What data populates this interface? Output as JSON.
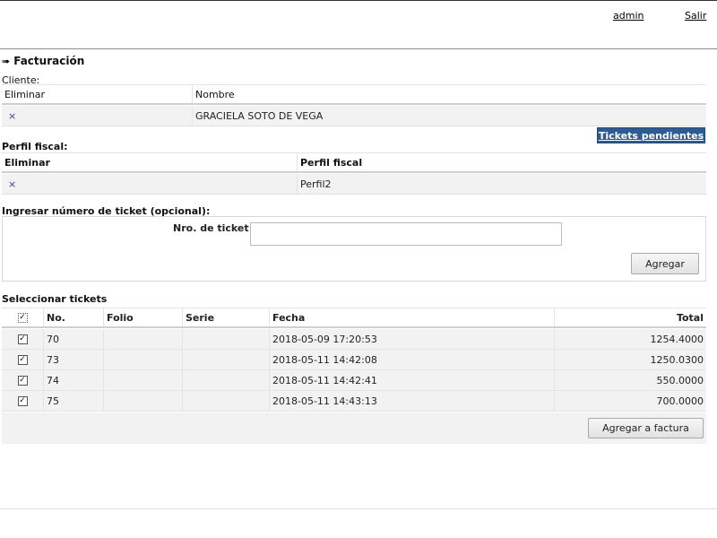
{
  "header": {
    "user_link": "admin",
    "logout_link": "Salir"
  },
  "section": {
    "title": "Facturación",
    "arrow": "➠"
  },
  "cliente": {
    "label": "Cliente:",
    "columns": [
      "Eliminar",
      "Nombre"
    ],
    "rows": [
      {
        "remove": "×",
        "nombre": "GRACIELA SOTO DE VEGA"
      }
    ]
  },
  "pendientes_button": "Tickets pendientes",
  "perfil": {
    "label": "Perfil fiscal:",
    "columns": [
      "Eliminar",
      "Perfil fiscal"
    ],
    "rows": [
      {
        "remove": "×",
        "perfil": "Perfil2"
      }
    ]
  },
  "ticket_entry": {
    "section_label": "Ingresar número de ticket (opcional):",
    "field_label": "Nro. de ticket",
    "value": "",
    "placeholder": "",
    "add_button": "Agregar"
  },
  "tickets": {
    "label": "Seleccionar tickets",
    "header_checkbox": "✓",
    "columns": [
      "No.",
      "Folio",
      "Serie",
      "Fecha",
      "Total"
    ],
    "rows": [
      {
        "checked": "✓",
        "no": "70",
        "folio": "",
        "serie": "",
        "fecha": "2018-05-09 17:20:53",
        "total": "1254.4000"
      },
      {
        "checked": "✓",
        "no": "73",
        "folio": "",
        "serie": "",
        "fecha": "2018-05-11 14:42:08",
        "total": "1250.0300"
      },
      {
        "checked": "✓",
        "no": "74",
        "folio": "",
        "serie": "",
        "fecha": "2018-05-11 14:42:41",
        "total": "550.0000"
      },
      {
        "checked": "✓",
        "no": "75",
        "folio": "",
        "serie": "",
        "fecha": "2018-05-11 14:43:13",
        "total": "700.0000"
      }
    ],
    "add_to_invoice_button": "Agregar a factura"
  },
  "colors": {
    "primary_button": "#2f5b93",
    "remove_icon": "#2b3fb8",
    "row_bg": "#f2f2f2"
  }
}
